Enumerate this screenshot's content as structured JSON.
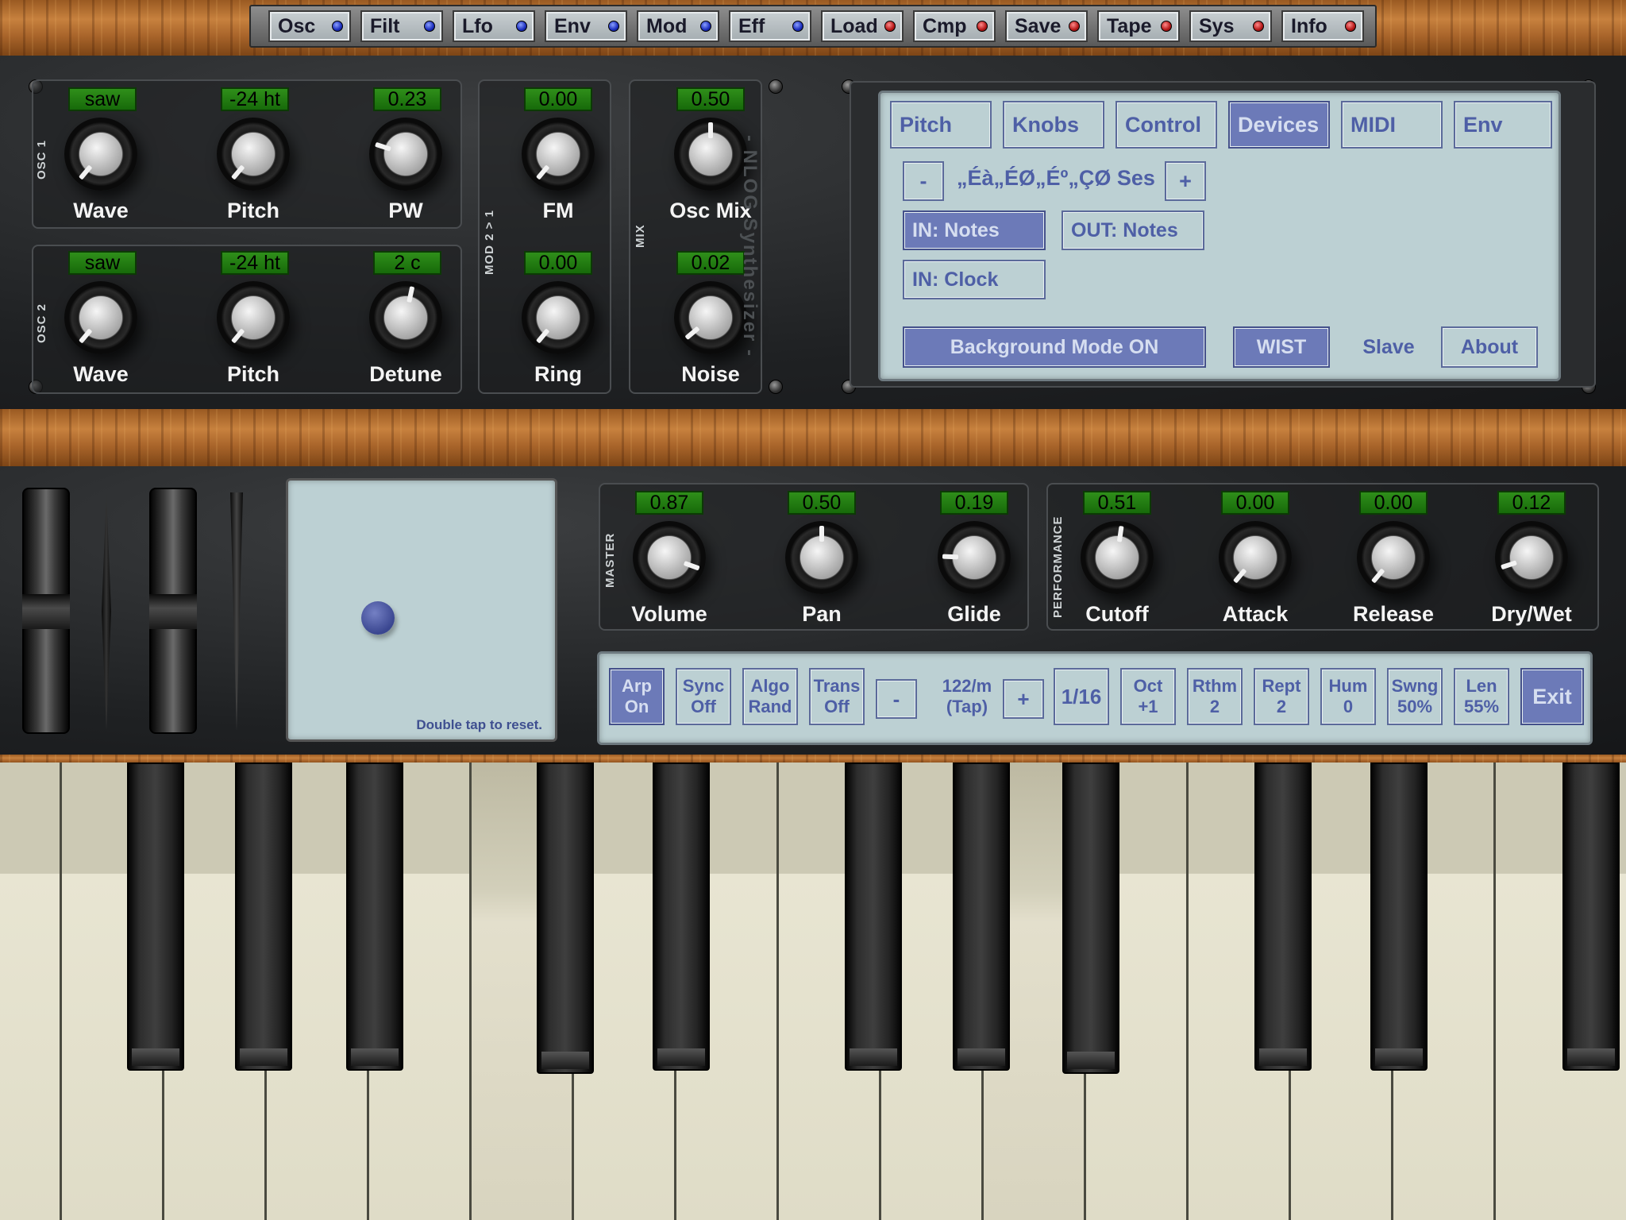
{
  "topbar": {
    "tabs": [
      {
        "label": "Osc",
        "led": "blue"
      },
      {
        "label": "Filt",
        "led": "blue"
      },
      {
        "label": "Lfo",
        "led": "blue"
      },
      {
        "label": "Env",
        "led": "blue"
      },
      {
        "label": "Mod",
        "led": "blue"
      },
      {
        "label": "Eff",
        "led": "blue"
      },
      {
        "label": "Load",
        "led": "red"
      },
      {
        "label": "Cmp",
        "led": "red"
      },
      {
        "label": "Save",
        "led": "red"
      },
      {
        "label": "Tape",
        "led": "red"
      },
      {
        "label": "Sys",
        "led": "red"
      },
      {
        "label": "Info",
        "led": "red"
      }
    ]
  },
  "osc1": {
    "label": "OSC 1",
    "wave": {
      "value": "saw",
      "label": "Wave"
    },
    "pitch": {
      "value": "-24 ht",
      "label": "Pitch"
    },
    "pw": {
      "value": "0.23",
      "label": "PW"
    }
  },
  "osc2": {
    "label": "OSC 2",
    "wave": {
      "value": "saw",
      "label": "Wave"
    },
    "pitch": {
      "value": "-24 ht",
      "label": "Pitch"
    },
    "detune": {
      "value": "2 c",
      "label": "Detune"
    }
  },
  "mod": {
    "label": "MOD 2 > 1",
    "fm": {
      "value": "0.00",
      "label": "FM"
    },
    "ring": {
      "value": "0.00",
      "label": "Ring"
    }
  },
  "mix": {
    "label": "MIX",
    "oscmix": {
      "value": "0.50",
      "label": "Osc Mix"
    },
    "noise": {
      "value": "0.02",
      "label": "Noise"
    }
  },
  "brand": "- NLOG Synthesizer -",
  "sys": {
    "tabs": [
      "Pitch",
      "Knobs",
      "Control",
      "Devices",
      "MIDI",
      "Env"
    ],
    "active_tab": "Devices",
    "minus": "-",
    "plus": "+",
    "device": "„Éà„ÉØ„Éº„ÇØ Ses",
    "in_notes": "IN: Notes",
    "out_notes": "OUT: Notes",
    "in_clock": "IN: Clock",
    "bg_mode": "Background Mode ON",
    "wist": "WIST",
    "slave": "Slave",
    "about": "About"
  },
  "xy": {
    "hint": "Double tap to reset."
  },
  "master": {
    "label": "MASTER",
    "volume": {
      "value": "0.87",
      "label": "Volume"
    },
    "pan": {
      "value": "0.50",
      "label": "Pan"
    },
    "glide": {
      "value": "0.19",
      "label": "Glide"
    }
  },
  "performance": {
    "label": "PERFORMANCE",
    "cutoff": {
      "value": "0.51",
      "label": "Cutoff"
    },
    "attack": {
      "value": "0.00",
      "label": "Attack"
    },
    "release": {
      "value": "0.00",
      "label": "Release"
    },
    "drywet": {
      "value": "0.12",
      "label": "Dry/Wet"
    }
  },
  "arp": {
    "buttons": [
      {
        "l1": "Arp",
        "l2": "On"
      },
      {
        "l1": "Sync",
        "l2": "Off"
      },
      {
        "l1": "Algo",
        "l2": "Rand"
      },
      {
        "l1": "Trans",
        "l2": "Off"
      }
    ],
    "minus": "-",
    "tempo1": "122/m",
    "tempo2": "(Tap)",
    "plus": "+",
    "division": "1/16",
    "params": [
      {
        "l1": "Oct",
        "l2": "+1"
      },
      {
        "l1": "Rthm",
        "l2": "2"
      },
      {
        "l1": "Rept",
        "l2": "2"
      },
      {
        "l1": "Hum",
        "l2": "0"
      },
      {
        "l1": "Swng",
        "l2": "50%"
      },
      {
        "l1": "Len",
        "l2": "55%"
      }
    ],
    "exit": "Exit"
  },
  "colors": {
    "lcd_green": "#2f8f1a",
    "panel_bg": "#bcd0d3",
    "button_active": "#6c7ab8",
    "button_text": "#4e5fa6"
  }
}
